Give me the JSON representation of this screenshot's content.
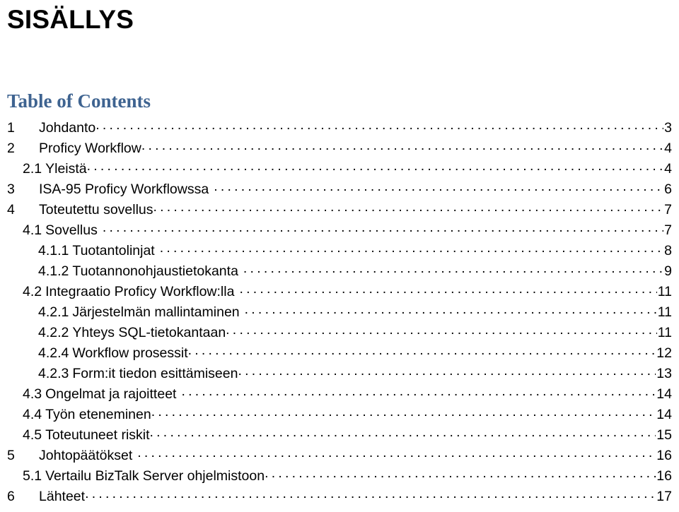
{
  "document": {
    "title": "SISÄLLYS",
    "toc_heading": "Table of Contents",
    "heading_color": "#3E6390",
    "text_color": "#000000",
    "background_color": "#FFFFFF",
    "leader_character": "."
  },
  "toc": {
    "entries": [
      {
        "number": "1",
        "label": "Johdanto",
        "page": "3",
        "level": 1,
        "gap_before_leader": false
      },
      {
        "number": "2",
        "label": "Proficy Workflow",
        "page": "4",
        "level": 1,
        "gap_before_leader": false
      },
      {
        "number": "2.1",
        "label": "Yleistä",
        "page": "4",
        "level": 2,
        "gap_before_leader": false
      },
      {
        "number": "3",
        "label": "ISA-95 Proficy Workflowssa",
        "page": "6",
        "level": 1,
        "gap_before_leader": true
      },
      {
        "number": "4",
        "label": "Toteutettu sovellus",
        "page": "7",
        "level": 1,
        "gap_before_leader": false
      },
      {
        "number": "4.1",
        "label": "Sovellus",
        "page": "7",
        "level": 2,
        "gap_before_leader": true
      },
      {
        "number": "4.1.1",
        "label": "Tuotantolinjat",
        "page": "8",
        "level": 3,
        "gap_before_leader": true
      },
      {
        "number": "4.1.2",
        "label": "Tuotannonohjaustietokanta",
        "page": "9",
        "level": 3,
        "gap_before_leader": true
      },
      {
        "number": "4.2",
        "label": "Integraatio Proficy Workflow:lla",
        "page": "11",
        "level": 2,
        "gap_before_leader": true
      },
      {
        "number": "4.2.1",
        "label": "Järjestelmän mallintaminen",
        "page": "11",
        "level": 3,
        "gap_before_leader": true
      },
      {
        "number": "4.2.2",
        "label": "Yhteys SQL-tietokantaan",
        "page": "11",
        "level": 3,
        "gap_before_leader": false
      },
      {
        "number": "4.2.4",
        "label": "Workflow prosessit",
        "page": "12",
        "level": 3,
        "gap_before_leader": false
      },
      {
        "number": "4.2.3",
        "label": "Form:it tiedon esittämiseen",
        "page": "13",
        "level": 3,
        "gap_before_leader": false
      },
      {
        "number": "4.3",
        "label": "Ongelmat ja rajoitteet",
        "page": "14",
        "level": 2,
        "gap_before_leader": true
      },
      {
        "number": "4.4",
        "label": "Työn eteneminen",
        "page": "14",
        "level": 2,
        "gap_before_leader": false
      },
      {
        "number": "4.5",
        "label": "Toteutuneet riskit",
        "page": "15",
        "level": 2,
        "gap_before_leader": false
      },
      {
        "number": "5",
        "label": "Johtopäätökset",
        "page": "16",
        "level": 1,
        "gap_before_leader": true
      },
      {
        "number": "5.1",
        "label": "Vertailu BizTalk Server ohjelmistoon",
        "page": "16",
        "level": 2,
        "gap_before_leader": false
      },
      {
        "number": "6",
        "label": "Lähteet",
        "page": "17",
        "level": 1,
        "gap_before_leader": false
      }
    ]
  }
}
